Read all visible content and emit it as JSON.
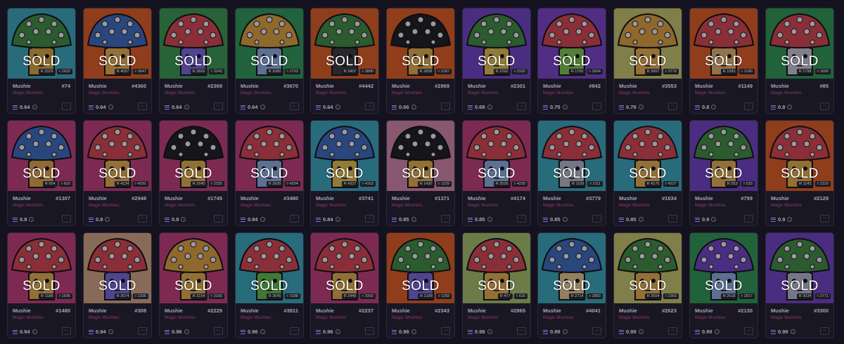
{
  "cards": [
    {
      "name": "Mushie",
      "number": "#74",
      "collection": "Magic Mushies",
      "price": "0.64",
      "badge": "SOLD",
      "stat1": "3329",
      "stat2": "2632",
      "bg": "#3aa9b9",
      "cap": "#3f8e3e",
      "face": "#d9a63c"
    },
    {
      "name": "Mushie",
      "number": "#4360",
      "collection": "Magic Mushies",
      "price": "0.64",
      "badge": "SOLD",
      "stat1": "4097",
      "stat2": "3647",
      "bg": "#e15e1f",
      "cap": "#3c6dbd",
      "face": "#e8b04b"
    },
    {
      "name": "Mushie",
      "number": "#2369",
      "collection": "Magic Mushies",
      "price": "0.64",
      "badge": "SOLD",
      "stat1": "3665",
      "stat2": "3243",
      "bg": "#3a9a4c",
      "cap": "#d8474d",
      "face": "#7a6ad8"
    },
    {
      "name": "Mushie",
      "number": "#3670",
      "collection": "Magic Mushies",
      "price": "0.64",
      "badge": "SOLD",
      "stat1": "2080",
      "stat2": "2793",
      "bg": "#2e9b55",
      "cap": "#e0a43a",
      "face": "#8fb0e0"
    },
    {
      "name": "Mushie",
      "number": "#4442",
      "collection": "Magic Mushies",
      "price": "0.64",
      "badge": "SOLD",
      "stat1": "2407",
      "stat2": "3880",
      "bg": "#e05f1f",
      "cap": "#3f8e3e",
      "face": "#3b3b3b"
    },
    {
      "name": "Mushie",
      "number": "#2969",
      "collection": "Magic Mushies",
      "price": "0.66",
      "badge": "SOLD",
      "stat1": "2808",
      "stat2": "2187",
      "bg": "#e35f1e",
      "cap": "#1d1d1d",
      "face": "#e5b046"
    },
    {
      "name": "Mushie",
      "number": "#2301",
      "collection": "Magic Mushies",
      "price": "0.69",
      "badge": "SOLD",
      "stat1": "2262",
      "stat2": "2332",
      "bg": "#7244c2",
      "cap": "#3f8e3e",
      "face": "#e4c24a"
    },
    {
      "name": "Mushie",
      "number": "#842",
      "collection": "Magic Mushies",
      "price": "0.75",
      "badge": "SOLD",
      "stat1": "1765",
      "stat2": "2604",
      "bg": "#7c45c8",
      "cap": "#d8474d",
      "face": "#7fc74a"
    },
    {
      "name": "Mushie",
      "number": "#3553",
      "collection": "Magic Mushies",
      "price": "0.79",
      "badge": "SOLD",
      "stat1": "3667",
      "stat2": "3779",
      "bg": "#c9c76a",
      "cap": "#e0a43a",
      "face": "#e8b04b"
    },
    {
      "name": "Mushie",
      "number": "#1149",
      "collection": "Magic Mushies",
      "price": "0.8",
      "badge": "SOLD",
      "stat1": "1583",
      "stat2": "1240",
      "bg": "#e15e1f",
      "cap": "#d8474d",
      "face": "#e6b36a"
    },
    {
      "name": "Mushie",
      "number": "#85",
      "collection": "Magic Mushies",
      "price": "0.8",
      "badge": "SOLD",
      "stat1": "1798",
      "stat2": "1695",
      "bg": "#2f9a52",
      "cap": "#d8474d",
      "face": "#c9c9d4"
    },
    {
      "name": "Mushie",
      "number": "#1307",
      "collection": "Magic Mushies",
      "price": "0.8",
      "badge": "SOLD",
      "stat1": "604",
      "stat2": "810",
      "bg": "#c33f7a",
      "cap": "#3c6dbd",
      "face": "#e2a64a"
    },
    {
      "name": "Mushie",
      "number": "#2948",
      "collection": "Magic Mushies",
      "price": "0.8",
      "badge": "SOLD",
      "stat1": "4134",
      "stat2": "4291",
      "bg": "#c33f7a",
      "cap": "#d8474d",
      "face": "#e8b04b"
    },
    {
      "name": "Mushie",
      "number": "#1745",
      "collection": "Magic Mushies",
      "price": "0.8",
      "badge": "SOLD",
      "stat1": "1640",
      "stat2": "2325",
      "bg": "#c33f7a",
      "cap": "#1d1d1d",
      "face": "#e5b046"
    },
    {
      "name": "Mushie",
      "number": "#3480",
      "collection": "Magic Mushies",
      "price": "0.84",
      "badge": "SOLD",
      "stat1": "3939",
      "stat2": "4204",
      "bg": "#c33f7a",
      "cap": "#d8474d",
      "face": "#8fb0e0"
    },
    {
      "name": "Mushie",
      "number": "#3741",
      "collection": "Magic Mushies",
      "price": "0.84",
      "badge": "SOLD",
      "stat1": "4337",
      "stat2": "4163",
      "bg": "#3aa9b9",
      "cap": "#3c6dbd",
      "face": "#e4c24a"
    },
    {
      "name": "Mushie",
      "number": "#1371",
      "collection": "Magic Mushies",
      "price": "0.85",
      "badge": "SOLD",
      "stat1": "1430",
      "stat2": "1229",
      "bg": "#d58aa8",
      "cap": "#1d1d1d",
      "face": "#e5b046"
    },
    {
      "name": "Mushie",
      "number": "#4174",
      "collection": "Magic Mushies",
      "price": "0.85",
      "badge": "SOLD",
      "stat1": "3526",
      "stat2": "4225",
      "bg": "#c33f7a",
      "cap": "#d8474d",
      "face": "#8fb0e0"
    },
    {
      "name": "Mushie",
      "number": "#3779",
      "collection": "Magic Mushies",
      "price": "0.85",
      "badge": "SOLD",
      "stat1": "1169",
      "stat2": "2111",
      "bg": "#3aa9b9",
      "cap": "#d8474d",
      "face": "#b8bcc8"
    },
    {
      "name": "Mushie",
      "number": "#1634",
      "collection": "Magic Mushies",
      "price": "0.85",
      "badge": "SOLD",
      "stat1": "4176",
      "stat2": "4227",
      "bg": "#3aa9b9",
      "cap": "#d8474d",
      "face": "#e8b04b"
    },
    {
      "name": "Mushie",
      "number": "#799",
      "collection": "Magic Mushies",
      "price": "0.9",
      "badge": "SOLD",
      "stat1": "553",
      "stat2": "533",
      "bg": "#7244c2",
      "cap": "#3f8e3e",
      "face": "#e8b04b"
    },
    {
      "name": "Mushie",
      "number": "#2129",
      "collection": "Magic Mushies",
      "price": "0.9",
      "badge": "SOLD",
      "stat1": "1143",
      "stat2": "2310",
      "bg": "#e15e1f",
      "cap": "#d8474d",
      "face": "#e5b046"
    },
    {
      "name": "Mushie",
      "number": "#1480",
      "collection": "Magic Mushies",
      "price": "0.94",
      "badge": "SOLD",
      "stat1": "1188",
      "stat2": "1696",
      "bg": "#c33f7a",
      "cap": "#d8474d",
      "face": "#e5b046"
    },
    {
      "name": "Mushie",
      "number": "#308",
      "collection": "Magic Mushies",
      "price": "0.94",
      "badge": "SOLD",
      "stat1": "3074",
      "stat2": "2335",
      "bg": "#d4a882",
      "cap": "#d8474d",
      "face": "#7a6ad8"
    },
    {
      "name": "Mushie",
      "number": "#2229",
      "collection": "Magic Mushies",
      "price": "0.96",
      "badge": "SOLD",
      "stat1": "2154",
      "stat2": "3183",
      "bg": "#c33f7a",
      "cap": "#e0a43a",
      "face": "#e5b046"
    },
    {
      "name": "Mushie",
      "number": "#3911",
      "collection": "Magic Mushies",
      "price": "0.96",
      "badge": "SOLD",
      "stat1": "3645",
      "stat2": "3188",
      "bg": "#3aa9b9",
      "cap": "#d8474d",
      "face": "#5fbf4a"
    },
    {
      "name": "Mushie",
      "number": "#2237",
      "collection": "Magic Mushies",
      "price": "0.96",
      "badge": "SOLD",
      "stat1": "2440",
      "stat2": "3392",
      "bg": "#c33f7a",
      "cap": "#d8474d",
      "face": "#e5b046"
    },
    {
      "name": "Mushie",
      "number": "#2343",
      "collection": "Magic Mushies",
      "price": "0.98",
      "badge": "SOLD",
      "stat1": "2188",
      "stat2": "1158",
      "bg": "#e15e1f",
      "cap": "#3f8e3e",
      "face": "#7a6ad8"
    },
    {
      "name": "Mushie",
      "number": "#2865",
      "collection": "Magic Mushies",
      "price": "0.98",
      "badge": "SOLD",
      "stat1": "477",
      "stat2": "615",
      "bg": "#a6c46a",
      "cap": "#d8474d",
      "face": "#e8b04b"
    },
    {
      "name": "Mushie",
      "number": "#4041",
      "collection": "Magic Mushies",
      "price": "0.99",
      "badge": "SOLD",
      "stat1": "2714",
      "stat2": "2883",
      "bg": "#3aa9b9",
      "cap": "#3c6dbd",
      "face": "#e8c88a"
    },
    {
      "name": "Mushie",
      "number": "#2623",
      "collection": "Magic Mushies",
      "price": "0.99",
      "badge": "SOLD",
      "stat1": "2504",
      "stat2": "2303",
      "bg": "#c9c76a",
      "cap": "#3f8e3e",
      "face": "#e8b04b"
    },
    {
      "name": "Mushie",
      "number": "#2130",
      "collection": "Magic Mushies",
      "price": "0.99",
      "badge": "SOLD",
      "stat1": "2618",
      "stat2": "2917",
      "bg": "#2f9a52",
      "cap": "#7244c2",
      "face": "#8fb0e0"
    },
    {
      "name": "Mushie",
      "number": "#3300",
      "collection": "Magic Mushies",
      "price": "0.99",
      "badge": "SOLD",
      "stat1": "3034",
      "stat2": "2771",
      "bg": "#7244c2",
      "cap": "#3f8e3e",
      "face": "#b8bcc8"
    }
  ]
}
